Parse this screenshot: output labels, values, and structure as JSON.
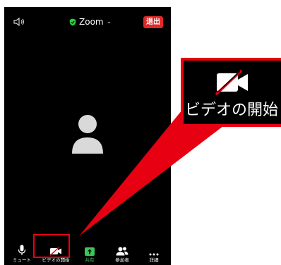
{
  "topbar": {
    "app_title": "Zoom",
    "title_chevron": "⌄",
    "leave_label": "退出",
    "shield_color": "#2ecc40"
  },
  "toolbar": {
    "items": [
      {
        "label": "ミュート",
        "icon": "microphone-icon"
      },
      {
        "label": "ビデオの開始",
        "icon": "video-off-icon"
      },
      {
        "label": "共有",
        "icon": "share-screen-icon"
      },
      {
        "label": "参加者",
        "icon": "participants-icon"
      },
      {
        "label": "詳細",
        "icon": "more-icon"
      }
    ]
  },
  "callout": {
    "label": "ビデオの開始",
    "icon": "video-off-icon"
  },
  "colors": {
    "highlight": "#e60012",
    "share_green": "#3ec45a",
    "leave_red": "#e02828"
  }
}
